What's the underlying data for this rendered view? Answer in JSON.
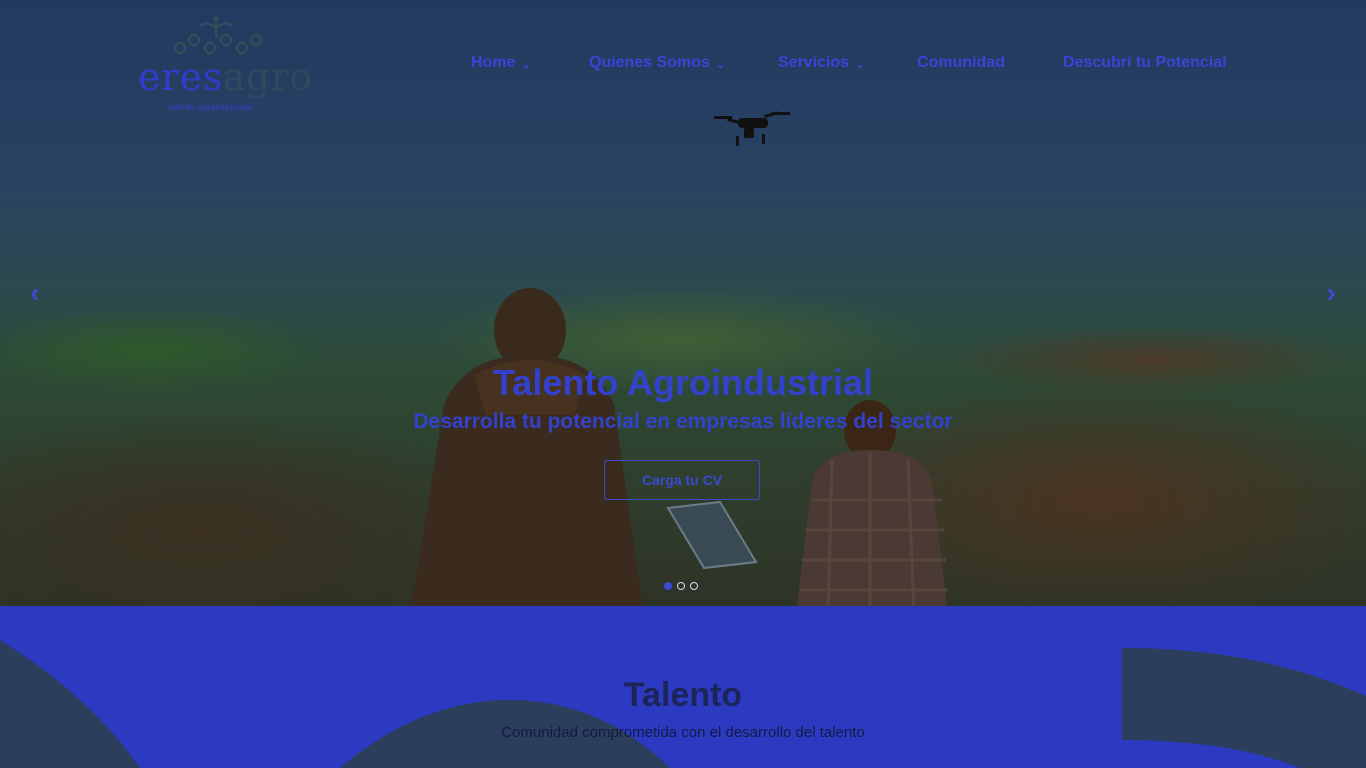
{
  "brand": {
    "word_part1": "eres",
    "word_part2": "agro",
    "tagline": "talento agroindustrial"
  },
  "nav": {
    "items": [
      {
        "label": "Home",
        "has_dropdown": true
      },
      {
        "label": "Quienes Somos",
        "has_dropdown": true
      },
      {
        "label": "Servicios",
        "has_dropdown": true
      },
      {
        "label": "Comunidad",
        "has_dropdown": false
      },
      {
        "label": "Descubrí tu Potencial",
        "has_dropdown": false
      }
    ],
    "chevron": "⌄"
  },
  "hero": {
    "title": "Talento Agroindustrial",
    "subtitle": "Desarrolla tu potencial en empresas líderes del sector",
    "cta_label": "Carga tu CV",
    "prev_arrow": "‹",
    "next_arrow": "›",
    "slides_total": 3,
    "active_slide": 1
  },
  "section": {
    "title": "Talento",
    "subtitle": "Comunidad comprometida con el desarrollo del talento"
  },
  "colors": {
    "accent": "#2c3ac2",
    "text_accent": "#3242cc",
    "dark_navy": "#1d2558",
    "decor_shape": "#2b3e5c"
  },
  "icons": {
    "prev": "chevron-left-icon",
    "next": "chevron-right-icon",
    "drone": "drone-icon",
    "logo_mark": "sprout-logo-icon"
  }
}
